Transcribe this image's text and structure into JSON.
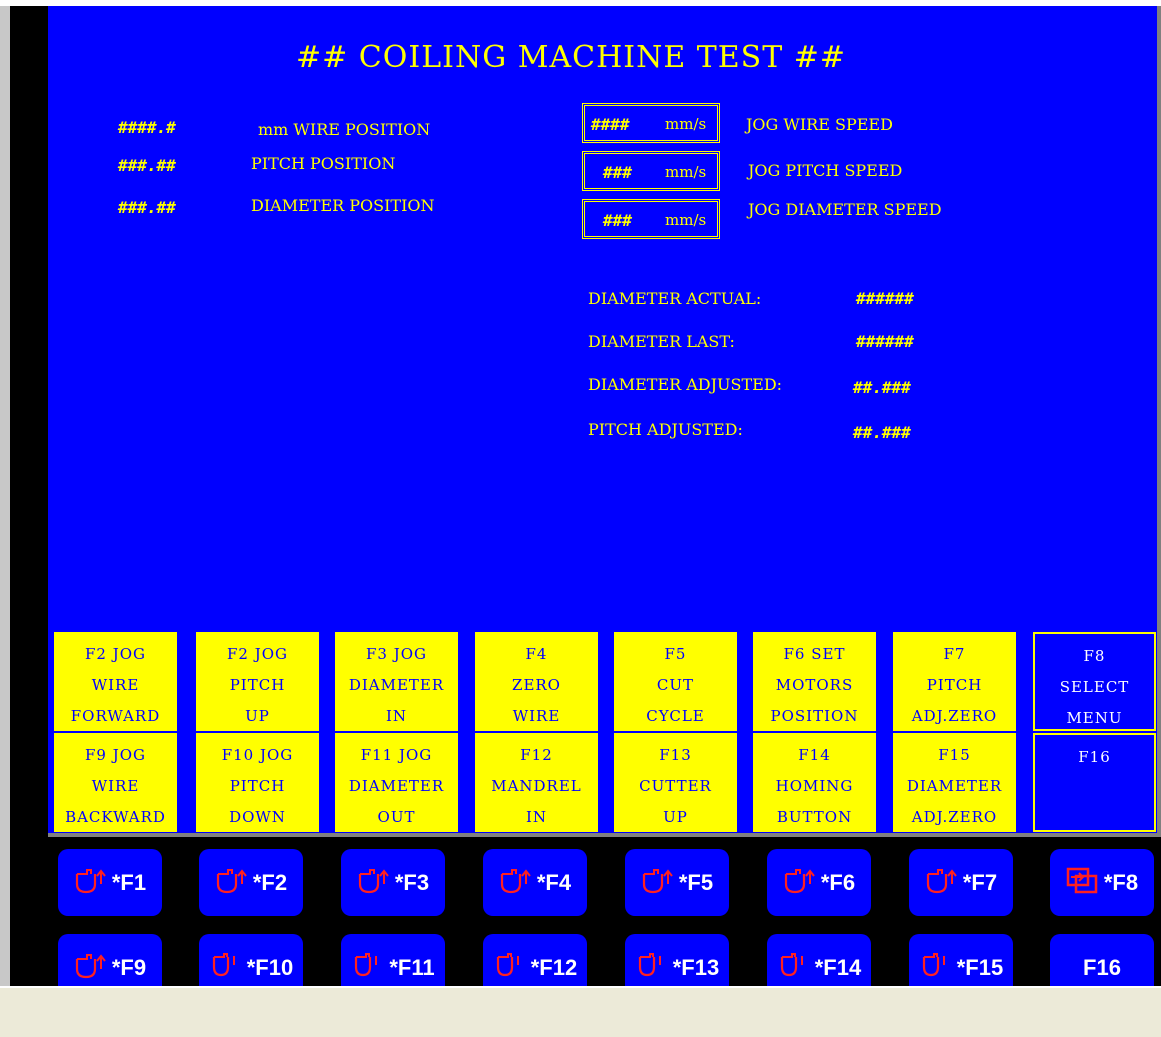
{
  "screen": {
    "title": "## COILING MACHINE TEST ##",
    "positions": [
      {
        "value": "####.#",
        "label": "mm WIRE POSITION"
      },
      {
        "value": "###.##",
        "label": "PITCH POSITION"
      },
      {
        "value": "###.##",
        "label": "DIAMETER POSITION"
      }
    ],
    "speeds": [
      {
        "value": "####",
        "unit": "mm/s",
        "label": "JOG WIRE SPEED"
      },
      {
        "value": "###",
        "unit": "mm/s",
        "label": "JOG PITCH SPEED"
      },
      {
        "value": "###",
        "unit": "mm/s",
        "label": "JOG DIAMETER SPEED"
      }
    ],
    "readouts": [
      {
        "label": "DIAMETER ACTUAL:",
        "value": "######"
      },
      {
        "label": "DIAMETER LAST:",
        "value": "######"
      },
      {
        "label": "DIAMETER ADJUSTED:",
        "value": "##.###"
      },
      {
        "label": "PITCH ADJUSTED:",
        "value": "##.###"
      }
    ]
  },
  "function_keys": [
    "F2 JOG\nWIRE\nFORWARD",
    "F2 JOG\nPITCH\nUP",
    "F3 JOG\nDIAMETER\nIN",
    "F4\nZERO\nWIRE",
    "F5\nCUT\nCYCLE",
    "F6 SET\nMOTORS\nPOSITION",
    "F7\nPITCH\nADJ.ZERO",
    "F8\nSELECT\nMENU",
    "F9 JOG\nWIRE\nBACKWARD",
    "F10 JOG\nPITCH\nDOWN",
    "F11 JOG\nDIAMETER\nOUT",
    "F12\nMANDREL\nIN",
    "F13\nCUTTER\nUP",
    "F14\nHOMING\nBUTTON",
    "F15\nDIAMETER\nADJ.ZERO",
    "F16"
  ],
  "panel_keys": [
    {
      "label": "*F1",
      "icon": "momentary-up-icon"
    },
    {
      "label": "*F2",
      "icon": "momentary-up-icon"
    },
    {
      "label": "*F3",
      "icon": "momentary-up-icon"
    },
    {
      "label": "*F4",
      "icon": "momentary-up-icon"
    },
    {
      "label": "*F5",
      "icon": "momentary-up-icon"
    },
    {
      "label": "*F6",
      "icon": "momentary-up-icon"
    },
    {
      "label": "*F7",
      "icon": "momentary-up-icon"
    },
    {
      "label": "*F8",
      "icon": "screen-jump-icon"
    },
    {
      "label": "*F9",
      "icon": "momentary-up-icon"
    },
    {
      "label": "*F10",
      "icon": "momentary-down-icon"
    },
    {
      "label": "*F11",
      "icon": "momentary-down-icon"
    },
    {
      "label": "*F12",
      "icon": "momentary-down-icon"
    },
    {
      "label": "*F13",
      "icon": "momentary-down-icon"
    },
    {
      "label": "*F14",
      "icon": "momentary-down-icon"
    },
    {
      "label": "*F15",
      "icon": "momentary-down-icon"
    },
    {
      "label": "F16",
      "icon": ""
    }
  ],
  "colors": {
    "screen_bg": "#0000ff",
    "text": "#ffff00",
    "key_bg": "#ffff00",
    "icon": "#ff2020"
  }
}
